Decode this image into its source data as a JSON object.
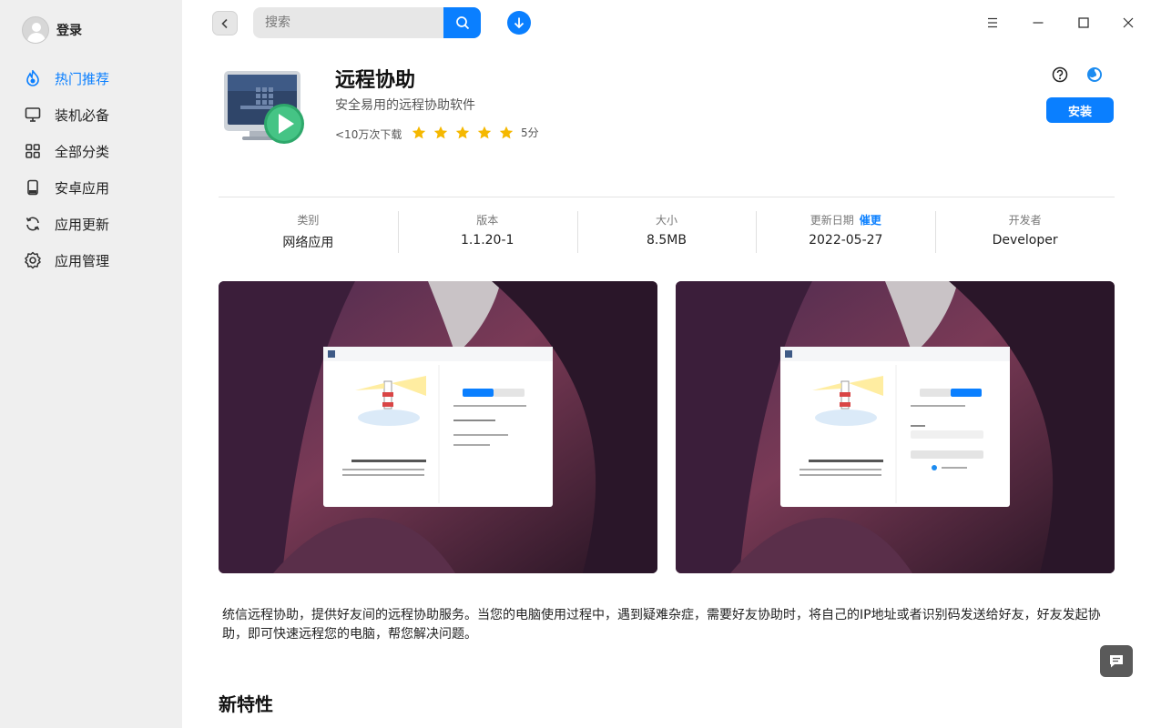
{
  "user": {
    "login_label": "登录"
  },
  "sidebar": {
    "items": [
      {
        "label": "热门推荐",
        "icon": "fire-icon",
        "active": true
      },
      {
        "label": "装机必备",
        "icon": "monitor-icon"
      },
      {
        "label": "全部分类",
        "icon": "grid-icon"
      },
      {
        "label": "安卓应用",
        "icon": "phone-icon"
      },
      {
        "label": "应用更新",
        "icon": "refresh-icon"
      },
      {
        "label": "应用管理",
        "icon": "gear-icon"
      }
    ]
  },
  "search": {
    "placeholder": "搜索"
  },
  "colors": {
    "accent": "#0a7fff",
    "star": "#f5b800",
    "sidebar_bg": "#efefef"
  },
  "app": {
    "name": "远程协助",
    "subtitle": "安全易用的远程协助软件",
    "downloads": "<10万次下载",
    "rating": 5,
    "rating_label": "5分",
    "install_label": "安装"
  },
  "info": {
    "category_label": "类别",
    "category_value": "网络应用",
    "version_label": "版本",
    "version_value": "1.1.20-1",
    "size_label": "大小",
    "size_value": "8.5MB",
    "date_label": "更新日期",
    "urge_label": "催更",
    "date_value": "2022-05-27",
    "developer_label": "开发者",
    "developer_value": "Developer"
  },
  "screenshots": [
    {
      "welcome": "欢迎使用远程协助",
      "tab_help": "我要求助",
      "tab_assist": "帮助别人",
      "active_tab": "help"
    },
    {
      "welcome": "欢迎使用远程协助",
      "tab_help": "我要求助",
      "tab_assist": "帮助别人",
      "active_tab": "assist"
    }
  ],
  "description": "统信远程协助，提供好友间的远程协助服务。当您的电脑使用过程中，遇到疑难杂症，需要好友协助时，将自己的IP地址或者识别码发送给好友，好友发起协助，即可快速远程您的电脑，帮您解决问题。",
  "new_features_title": "新特性"
}
